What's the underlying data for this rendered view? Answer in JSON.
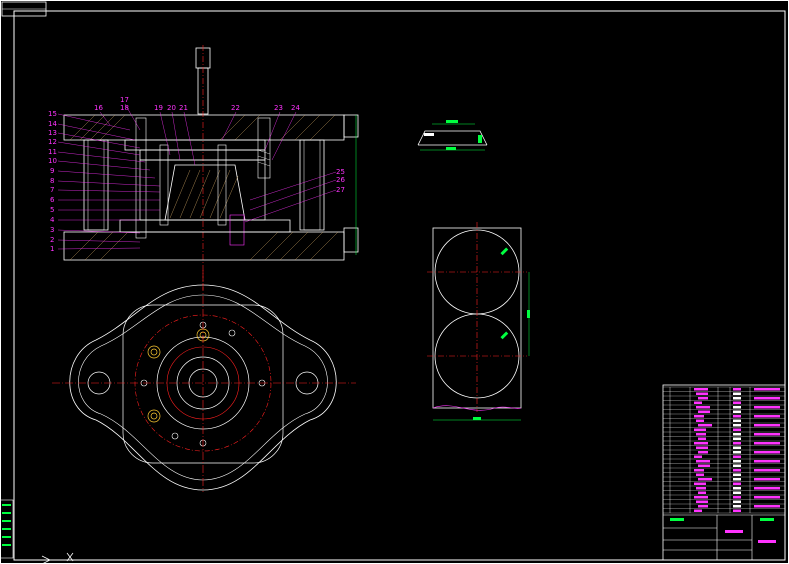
{
  "colors": {
    "background": "#000000",
    "outline": "#ffffff",
    "centerline": "#ff2020",
    "label": "#ff33ff",
    "hatch": "#c8a060",
    "dimension": "#00ff40",
    "cyan": "#00ffff"
  },
  "section_view": {
    "left_labels": [
      "15",
      "14",
      "13",
      "12",
      "11",
      "10",
      "9",
      "8",
      "7",
      "6",
      "5",
      "4",
      "3",
      "2",
      "1"
    ],
    "top_labels": [
      "16",
      "17",
      "18",
      "19",
      "20",
      "21",
      "22",
      "23",
      "24"
    ],
    "right_labels": [
      "25",
      "26",
      "27"
    ]
  },
  "title_block": {
    "label": "title-block"
  },
  "revision_block": {
    "label": "revision-block"
  }
}
